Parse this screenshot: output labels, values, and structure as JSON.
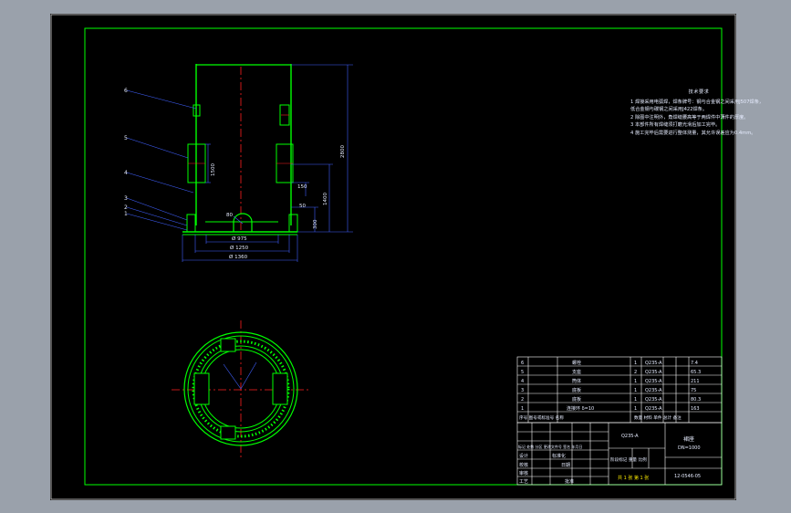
{
  "callouts": [
    "6",
    "5",
    "4",
    "3",
    "2",
    "1"
  ],
  "dimensions": {
    "height_total": "2800",
    "height_1400": "1400",
    "height_1500": "1500",
    "height_150": "150",
    "height_50": "50",
    "height_300": "300",
    "dia_80": "80",
    "dia_975": "Ø 975",
    "dia_1250": "Ø 1250",
    "dia_1360": "Ø 1360"
  },
  "notes": {
    "title": "技术要求",
    "lines": [
      "1  焊接采用电弧焊，焊条牌号：钢与合金钢之间采用J507焊条，低合金钢与碳钢之间采用J422焊条。",
      "2  除图中注明外，角焊缝腰高等于两焊件中薄件的厚度。",
      "3  本部件所有焊缝须打磨光滑后加工完毕。",
      "4  施工完毕后需要进行整体测量，其允许误差应为0.4mm。"
    ]
  },
  "parts_list": [
    {
      "no": "6",
      "name": "螺栓",
      "qty": "1",
      "material": "Q235-A",
      "weight": "7.4"
    },
    {
      "no": "5",
      "name": "支座",
      "qty": "2",
      "material": "Q235-A",
      "weight": "65.3"
    },
    {
      "no": "4",
      "name": "筒体",
      "qty": "1",
      "material": "Q235-A",
      "weight": "211"
    },
    {
      "no": "3",
      "name": "底板",
      "qty": "1",
      "material": "Q235-A",
      "weight": "75"
    },
    {
      "no": "2",
      "name": "底板",
      "qty": "1",
      "material": "Q235-A",
      "weight": "80.3"
    },
    {
      "no": "1",
      "name": "连接环 δ=10",
      "qty": "1",
      "material": "Q235-A",
      "weight": "163"
    }
  ],
  "title_block": {
    "header_row": "序号  图号或标准号  名称",
    "header_right": "数量  材料  单件  总计  备注",
    "material": "Q235-A",
    "revision_row": "标记 处数 分区 更改文件号 签名 年月日",
    "labels_left": [
      "设计",
      "校核",
      "审核",
      "工艺",
      "批准"
    ],
    "labels_mid": [
      "标准化",
      "日期"
    ],
    "scale_labels": "阶段标记  重量  比例",
    "drawing_name": "裙座",
    "drawing_spec": "DN=1000",
    "sheet": "共 1 张  第 1 张",
    "drawing_no": "12-0546-05"
  },
  "colors": {
    "background": "#000000",
    "frame": "#00ff00",
    "geometry": "#00ff00",
    "centerline": "#ff2020",
    "dimension": "#4060ff",
    "table": "#ffffff"
  }
}
